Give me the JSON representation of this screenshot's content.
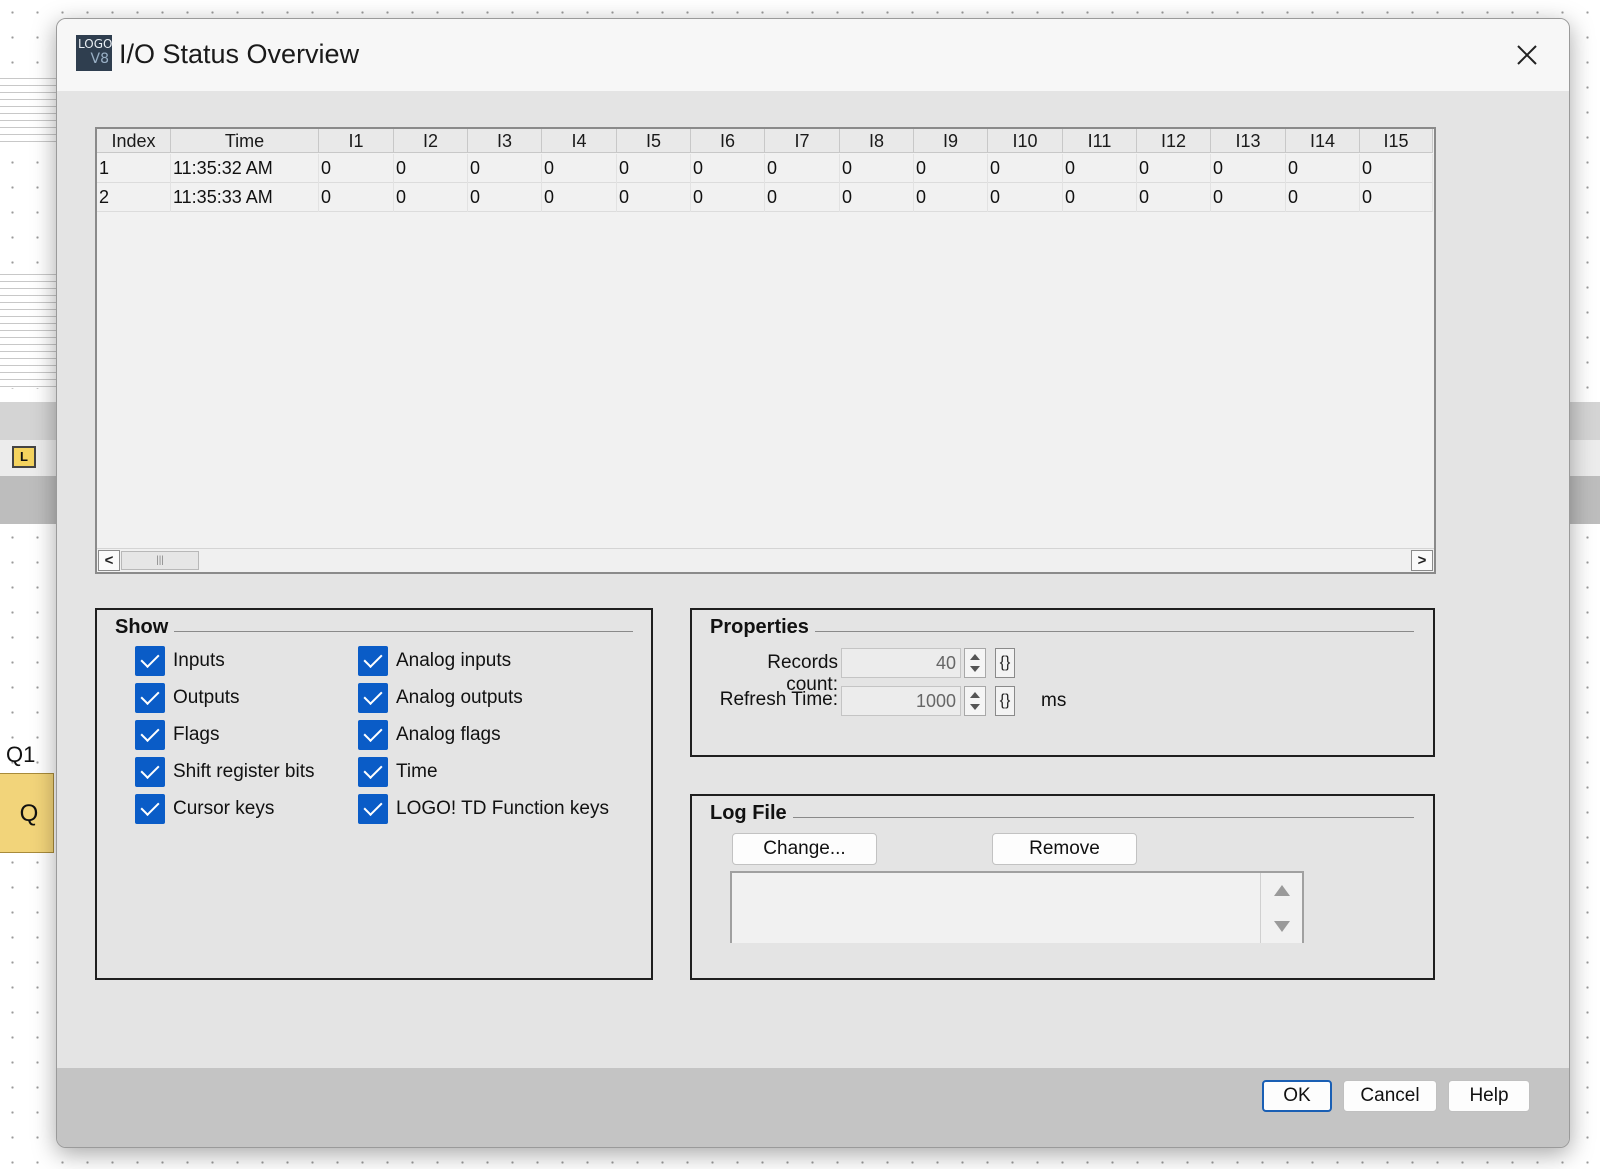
{
  "background": {
    "toolbar_icon_letter": "L",
    "block_label": "Q1",
    "block_text": "Q"
  },
  "dialog": {
    "app_icon_text_top": "LOGO",
    "app_icon_text_bottom": "V8",
    "title": "I/O Status Overview",
    "close_icon": "close-icon"
  },
  "table": {
    "columns": [
      "Index",
      "Time",
      "I1",
      "I2",
      "I3",
      "I4",
      "I5",
      "I6",
      "I7",
      "I8",
      "I9",
      "I10",
      "I11",
      "I12",
      "I13",
      "I14",
      "I15"
    ],
    "rows": [
      [
        "1",
        "11:35:32 AM",
        "0",
        "0",
        "0",
        "0",
        "0",
        "0",
        "0",
        "0",
        "0",
        "0",
        "0",
        "0",
        "0",
        "0",
        "0"
      ],
      [
        "2",
        "11:35:33 AM",
        "0",
        "0",
        "0",
        "0",
        "0",
        "0",
        "0",
        "0",
        "0",
        "0",
        "0",
        "0",
        "0",
        "0",
        "0"
      ]
    ],
    "scroll_left": "<",
    "scroll_right": ">",
    "scroll_thumb_grip": "|||"
  },
  "show": {
    "title": "Show",
    "items_left": [
      {
        "label": "Inputs",
        "checked": true
      },
      {
        "label": "Outputs",
        "checked": true
      },
      {
        "label": "Flags",
        "checked": true
      },
      {
        "label": "Shift register bits",
        "checked": true
      },
      {
        "label": "Cursor keys",
        "checked": true
      }
    ],
    "items_right": [
      {
        "label": "Analog inputs",
        "checked": true
      },
      {
        "label": "Analog outputs",
        "checked": true
      },
      {
        "label": "Analog flags",
        "checked": true
      },
      {
        "label": "Time",
        "checked": true
      },
      {
        "label": "LOGO! TD Function keys",
        "checked": true
      }
    ]
  },
  "properties": {
    "title": "Properties",
    "records_label": "Records count:",
    "records_value": "40",
    "refresh_label": "Refresh Time:",
    "refresh_value": "1000",
    "refresh_unit": "ms",
    "brace_glyph": "{}"
  },
  "logfile": {
    "title": "Log File",
    "change_label": "Change...",
    "remove_label": "Remove",
    "path_value": ""
  },
  "footer": {
    "ok_label": "OK",
    "cancel_label": "Cancel",
    "help_label": "Help"
  },
  "colors": {
    "checkbox_accent": "#0a5cc7",
    "ok_border": "#1a5fb4",
    "dialog_bg": "#e4e4e4"
  }
}
